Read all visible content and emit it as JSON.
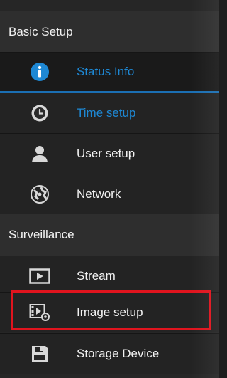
{
  "sections": {
    "basic_setup": "Basic Setup",
    "surveillance": "Surveillance"
  },
  "items": [
    {
      "label": "Status Info",
      "icon": "info-icon",
      "state": "active",
      "color": "#1e88d4"
    },
    {
      "label": "Time setup",
      "icon": "clock-icon",
      "color": "#1e88d4"
    },
    {
      "label": "User setup",
      "icon": "user-icon"
    },
    {
      "label": "Network",
      "icon": "network-globe-icon"
    },
    {
      "label": "Stream",
      "icon": "play-screen-icon"
    },
    {
      "label": "Image setup",
      "icon": "image-settings-icon",
      "highlighted": true
    },
    {
      "label": "Storage Device",
      "icon": "floppy-disk-icon"
    }
  ],
  "colors": {
    "highlight_border": "#e0141e",
    "active_text": "#1e88d4",
    "background": "#262626"
  }
}
